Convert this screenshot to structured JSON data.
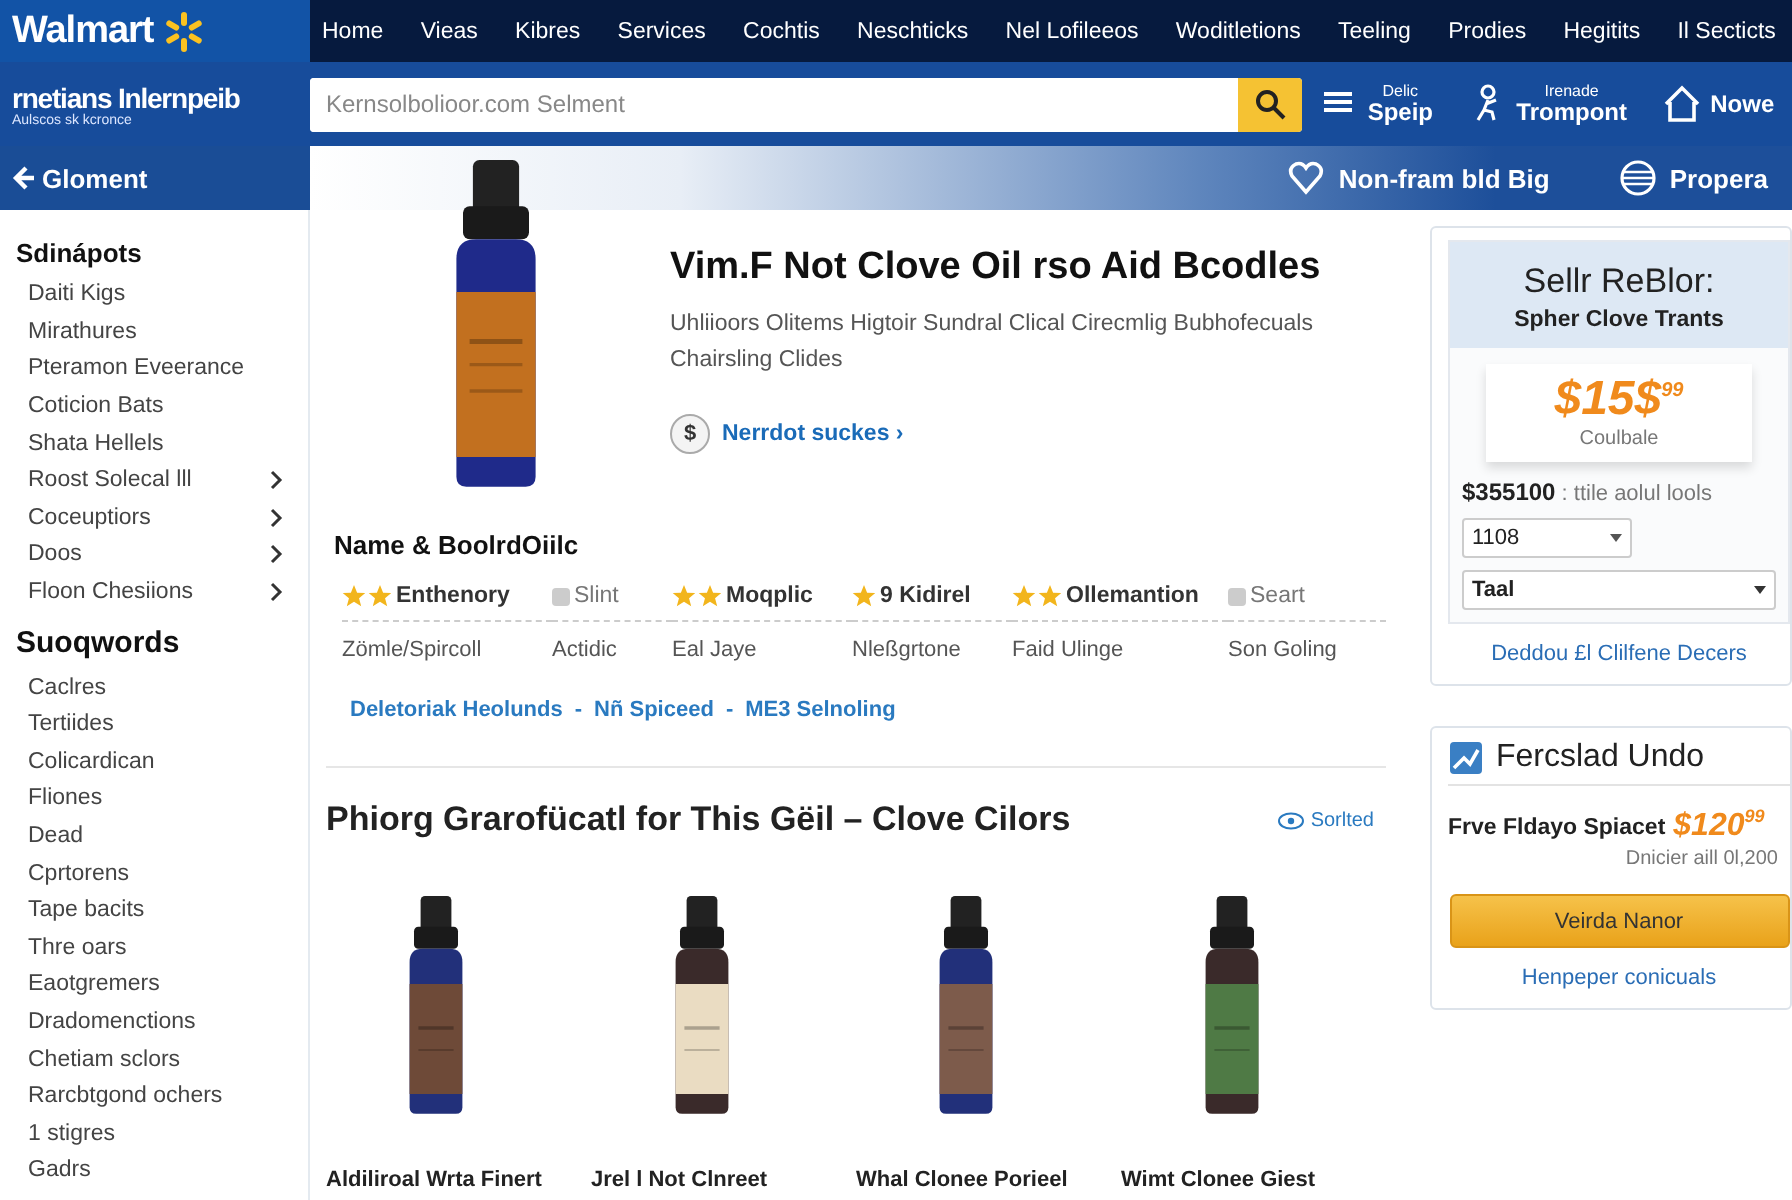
{
  "header": {
    "logo": "Walmart",
    "nav": [
      "Home",
      "Vieas",
      "Kibres",
      "Services",
      "Cochtis",
      "Neschticks",
      "Nel Lofileeos",
      "Woditletions",
      "Teeling",
      "Prodies",
      "Hegitits",
      "Il Secticts"
    ],
    "brand": {
      "name": "rnetians Inlernpeib",
      "tagline": "Aulscos sk kcronce"
    },
    "search": {
      "placeholder": "Kernsolbolioor.com Selment"
    },
    "actions": [
      {
        "kind": "list",
        "small": "Delic",
        "label": "Speip"
      },
      {
        "kind": "person",
        "small": "Irenade",
        "label": "Trompont"
      },
      {
        "kind": "home",
        "label": "Nowe"
      }
    ],
    "back": "Gloment",
    "banner_links": [
      {
        "kind": "heart",
        "label": "Non-fram bld Big"
      },
      {
        "kind": "globe",
        "label": "Propera"
      }
    ]
  },
  "sidebar": {
    "sections": [
      {
        "title": "Sdinápots",
        "items": [
          {
            "label": "Daiti Kigs",
            "chevron": false
          },
          {
            "label": "Mirathures",
            "chevron": false
          },
          {
            "label": "Pteramon Eveerance",
            "chevron": false
          },
          {
            "label": "Coticion Bats",
            "chevron": false
          },
          {
            "label": "Shata Hellels",
            "chevron": false
          },
          {
            "label": "Roost Solecal lll",
            "chevron": true
          },
          {
            "label": "Coceuptiors",
            "chevron": true
          },
          {
            "label": "Doos",
            "chevron": true
          },
          {
            "label": "Floon Chesiions",
            "chevron": true
          }
        ]
      },
      {
        "title": "Suoqwords",
        "items": [
          {
            "label": "Caclres",
            "chevron": false
          },
          {
            "label": "Tertiides",
            "chevron": false
          },
          {
            "label": "Colicardican",
            "chevron": false
          },
          {
            "label": "Fliones",
            "chevron": false
          },
          {
            "label": "Dead",
            "chevron": false
          },
          {
            "label": "Cprtorens",
            "chevron": false
          },
          {
            "label": "Tape bacits",
            "chevron": false
          },
          {
            "label": "Thre oars",
            "chevron": false
          },
          {
            "label": "Eaotgremers",
            "chevron": false
          },
          {
            "label": "Dradomenctions",
            "chevron": false
          },
          {
            "label": "Chetiam sclors",
            "chevron": false
          },
          {
            "label": "Rarcbtgond ochers",
            "chevron": false
          },
          {
            "label": "1 stigres",
            "chevron": false
          },
          {
            "label": "Gadrs",
            "chevron": false
          }
        ]
      }
    ]
  },
  "product": {
    "title": "Vim.F Not Clove Oil rso Aid Bcodles",
    "subtitle": "Uhliioors Olitems Higtoir Sundral Clical Cirecmlig Bubhofecuals Chairsling Clides",
    "link_icon": "$",
    "link": "Nerrdot suckes ›",
    "specs_title": "Name & BoolrdOiilc",
    "specs": [
      {
        "kind": "twostar",
        "label": "Enthenory",
        "value": "Zömle/Spircoll"
      },
      {
        "kind": "icon",
        "label": "Slint",
        "value": "Actidic"
      },
      {
        "kind": "twostar",
        "label": "Moqplic",
        "value": "Eal Jaye"
      },
      {
        "kind": "onestar",
        "label": "9 Kidirel",
        "value": "Nleßgrtone"
      },
      {
        "kind": "twostar",
        "label": "Ollemantion",
        "value": "Faid Ulinge"
      },
      {
        "kind": "icon",
        "label": "Seart",
        "value": "Son Goling"
      }
    ],
    "links": [
      "Deletoriak Heolunds",
      "Nñ Spiceed",
      "ME3 Selnoling"
    ],
    "separator": "-"
  },
  "recommendations": {
    "title": "Phiorg Grarofücatl for This Gëil – Clove Cilors",
    "sort": "Sorlted",
    "items": [
      {
        "name": "Aldiliroal Wrta Finert",
        "color": "#6e4a38"
      },
      {
        "name": "Jrel l Not Clnreet",
        "color": "#eadcc2"
      },
      {
        "name": "Whal Clonee Porieel",
        "color": "#7d5b4b"
      },
      {
        "name": "Wimt Clonee Giest",
        "color": "#4f7a45"
      }
    ]
  },
  "offer": {
    "title": "Sellr ReBlor:",
    "subtitle": "Spher Clove Trants",
    "price": "$15$",
    "cents": "99",
    "price_note": "Coulbale",
    "total": "$355100",
    "total_note": ": ttile aolul lools",
    "quantity": "1108",
    "option": "Taal",
    "link": "Deddou £l Clilfene Decers"
  },
  "deal": {
    "title": "Fercslad Undo",
    "label": "Frve Fldayo Spiacet",
    "price": "$120",
    "cents": "99",
    "note": "Dnicier aill 0l,200",
    "button": "Veirda Nanor",
    "link": "Henpeper conicuals"
  }
}
